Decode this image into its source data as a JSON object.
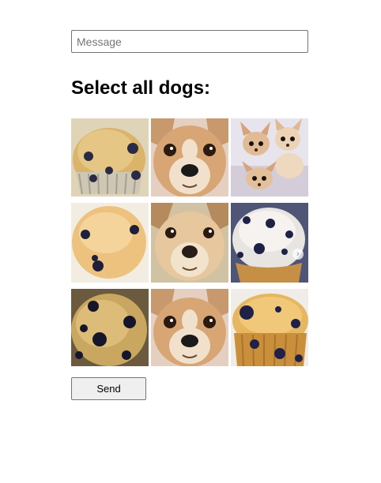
{
  "message_input": {
    "placeholder": "Message",
    "value": ""
  },
  "heading": "Select all dogs:",
  "grid": {
    "tiles": [
      {
        "subject": "blueberry-muffin"
      },
      {
        "subject": "chihuahua"
      },
      {
        "subject": "chihuahua-puppies"
      },
      {
        "subject": "blueberry-muffin"
      },
      {
        "subject": "chihuahua"
      },
      {
        "subject": "blueberry-muffin"
      },
      {
        "subject": "blueberry-muffin"
      },
      {
        "subject": "chihuahua"
      },
      {
        "subject": "blueberry-muffin"
      }
    ]
  },
  "send_button": {
    "label": "Send"
  },
  "colors": {
    "muffin": "#d9b46a",
    "dog": "#d6a473",
    "blueberry": "#1e1f3a"
  }
}
